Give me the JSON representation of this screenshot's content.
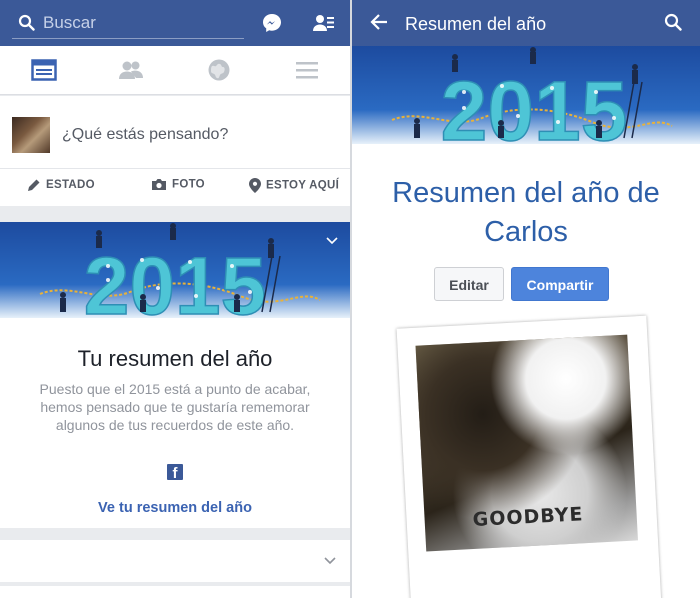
{
  "left": {
    "search": {
      "placeholder": "Buscar"
    },
    "composer": {
      "prompt": "¿Qué estás pensando?"
    },
    "actions": [
      {
        "label": "ESTADO",
        "icon": "pencil-icon"
      },
      {
        "label": "FOTO",
        "icon": "camera-icon"
      },
      {
        "label": "ESTOY AQUÍ",
        "icon": "location-pin-icon"
      }
    ],
    "card": {
      "banner_text": "2015",
      "title": "Tu resumen del año",
      "body": "Puesto que el 2015 está a punto de acabar, hemos pensado que te gustaría rememorar algunos de tus recuerdos de este año.",
      "logo": "f",
      "link": "Ve tu resumen del año"
    }
  },
  "right": {
    "title": "Resumen del año",
    "banner_text": "2015",
    "heading": "Resumen del año de Carlos",
    "edit_label": "Editar",
    "share_label": "Compartir",
    "photo_text": "GOODBYE"
  },
  "colors": {
    "brand": "#3b5998",
    "link": "#3b63b2",
    "share": "#4d84dc",
    "banner_digits": "#4ec5d6"
  }
}
